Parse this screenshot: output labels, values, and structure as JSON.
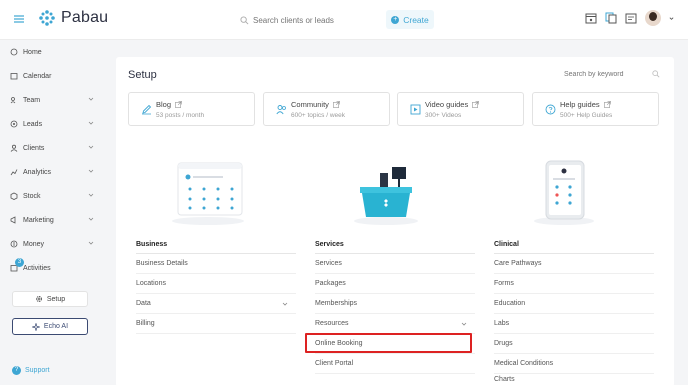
{
  "topbar": {
    "brand": "Pabau",
    "search_placeholder": "Search clients or leads",
    "create_label": "Create"
  },
  "sidebar": {
    "items": [
      {
        "label": "Home",
        "icon": "home-icon"
      },
      {
        "label": "Calendar",
        "icon": "calendar-icon"
      },
      {
        "label": "Team",
        "icon": "team-icon"
      },
      {
        "label": "Leads",
        "icon": "leads-icon"
      },
      {
        "label": "Clients",
        "icon": "clients-icon"
      },
      {
        "label": "Analytics",
        "icon": "analytics-icon"
      },
      {
        "label": "Stock",
        "icon": "stock-icon"
      },
      {
        "label": "Marketing",
        "icon": "marketing-icon"
      },
      {
        "label": "Money",
        "icon": "money-icon"
      },
      {
        "label": "Activities",
        "icon": "activities-icon"
      }
    ],
    "activities_badge": "3",
    "setup_label": "Setup",
    "echo_label": "Echo AI",
    "support_label": "Support"
  },
  "main": {
    "title": "Setup",
    "keyword_placeholder": "Search by keyword",
    "cards": [
      {
        "title": "Blog",
        "subtitle": "53 posts / month",
        "icon": "pencil-icon"
      },
      {
        "title": "Community",
        "subtitle": "600+ topics / week",
        "icon": "community-icon"
      },
      {
        "title": "Video guides",
        "subtitle": "300+ Videos",
        "icon": "video-icon"
      },
      {
        "title": "Help guides",
        "subtitle": "500+ Help Guides",
        "icon": "help-icon"
      }
    ],
    "columns": [
      {
        "title": "Business",
        "links": [
          "Business Details",
          "Locations",
          "Data",
          "Billing"
        ]
      },
      {
        "title": "Services",
        "links": [
          "Services",
          "Packages",
          "Memberships",
          "Resources",
          "Online Booking",
          "Client Portal"
        ]
      },
      {
        "title": "Clinical",
        "links": [
          "Care Pathways",
          "Forms",
          "Education",
          "Labs",
          "Drugs",
          "Medical Conditions",
          "Charts"
        ]
      }
    ]
  },
  "colors": {
    "accent": "#3ea6d3",
    "highlight": "#dd2222",
    "navy": "#3b4a72"
  }
}
